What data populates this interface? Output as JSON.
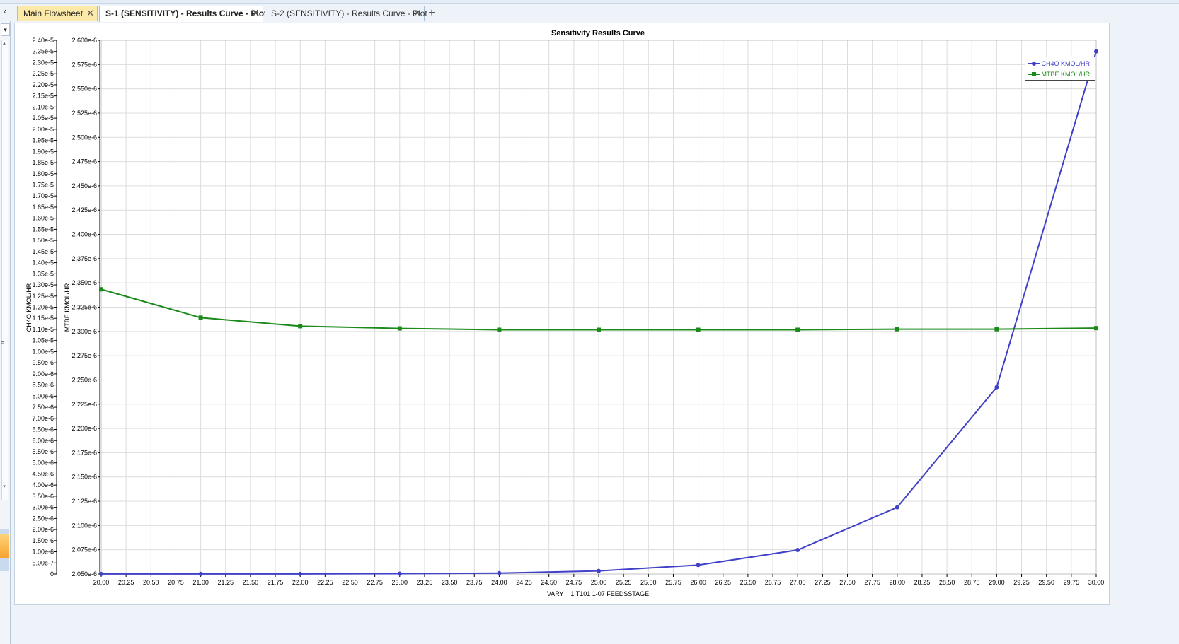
{
  "tabs": [
    {
      "label": "Main Flowsheet"
    },
    {
      "label": "S-1 (SENSITIVITY) - Results Curve - Plot"
    },
    {
      "label": "S-2 (SENSITIVITY) - Results Curve - Plot"
    }
  ],
  "tab_close_glyph": "✕",
  "tab_add_glyph": "+",
  "left_nav_glyph": "‹",
  "colors": {
    "ch4o": "#4040c8",
    "mtbe": "#1a8a1a",
    "grid": "#dcdcdc"
  },
  "chart_data": {
    "type": "line",
    "title": "Sensitivity Results Curve",
    "xlabel": "VARY    1 T101 1-07 FEEDSSTAGE",
    "xlim": [
      20,
      30
    ],
    "x_tick_step": 0.25,
    "y_axes": [
      {
        "label": "CH4O KMOL/HR",
        "ylim": [
          0,
          2.4e-05
        ],
        "tick_step": 5e-07,
        "format": "e2"
      },
      {
        "label": "MTBE KMOL/HR",
        "ylim": [
          2.05e-06,
          2.6e-06
        ],
        "tick_step": 2.5e-08,
        "format": "e3"
      }
    ],
    "grid": true,
    "legend_position": "top-right",
    "x": [
      20,
      21,
      22,
      23,
      24,
      25,
      26,
      27,
      28,
      29,
      30
    ],
    "series": [
      {
        "name": "CH4O KMOL/HR",
        "axis": 0,
        "marker": "circle",
        "values": [
          2e-09,
          3e-09,
          5e-09,
          1.5e-08,
          4e-08,
          1.4e-07,
          4e-07,
          1.08e-06,
          3e-06,
          8.4e-06,
          2.35e-05
        ]
      },
      {
        "name": "MTBE KMOL/HR",
        "axis": 1,
        "marker": "square",
        "values": [
          2.3434e-06,
          2.3142e-06,
          2.3054e-06,
          2.3031e-06,
          2.3017e-06,
          2.3017e-06,
          2.3017e-06,
          2.3017e-06,
          2.3023e-06,
          2.3023e-06,
          2.3034e-06
        ]
      }
    ]
  }
}
